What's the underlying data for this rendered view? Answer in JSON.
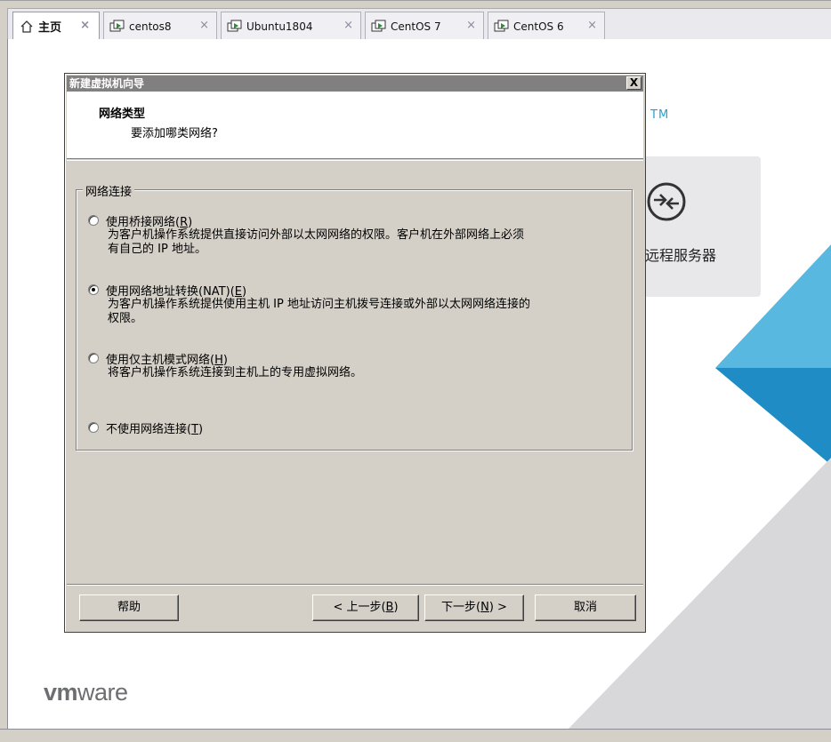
{
  "tabs": [
    {
      "label": "主页",
      "active": true,
      "icon": "home-icon"
    },
    {
      "label": "centos8",
      "active": false,
      "icon": "vm-icon"
    },
    {
      "label": "Ubuntu1804",
      "active": false,
      "icon": "vm-icon"
    },
    {
      "label": "CentOS 7",
      "active": false,
      "icon": "vm-icon"
    },
    {
      "label": "CentOS 6",
      "active": false,
      "icon": "vm-icon"
    }
  ],
  "tab_close_glyph": "×",
  "home": {
    "tm": "TM",
    "remote_label": "远程服务器",
    "logo_vm": "vm",
    "logo_ware": "ware",
    "accent_colors": {
      "light_blue": "#58b8df",
      "blue": "#1f8cc6",
      "gray": "#d8d8da"
    }
  },
  "dialog": {
    "title": "新建虚拟机向导",
    "close_glyph": "X",
    "header_title": "网络类型",
    "header_subtitle": "要添加哪类网络?",
    "group_label": "网络连接",
    "options": [
      {
        "label": "使用桥接网络",
        "key": "R",
        "checked": false,
        "desc1": "为客户机操作系统提供直接访问外部以太网网络的权限。客户机在外部网络上必须",
        "desc2": "有自己的 IP 地址。"
      },
      {
        "label": "使用网络地址转换(NAT)",
        "key": "E",
        "checked": true,
        "desc1": "为客户机操作系统提供使用主机 IP 地址访问主机拨号连接或外部以太网网络连接的",
        "desc2": "权限。"
      },
      {
        "label": "使用仅主机模式网络",
        "key": "H",
        "checked": false,
        "desc1": "将客户机操作系统连接到主机上的专用虚拟网络。",
        "desc2": ""
      },
      {
        "label": "不使用网络连接",
        "key": "T",
        "checked": false,
        "desc1": "",
        "desc2": ""
      }
    ],
    "buttons": {
      "help": "帮助",
      "back_pre": "< 上一步(",
      "back_key": "B",
      "back_post": ")",
      "next_pre": "下一步(",
      "next_key": "N",
      "next_post": ") >",
      "cancel": "取消"
    }
  }
}
